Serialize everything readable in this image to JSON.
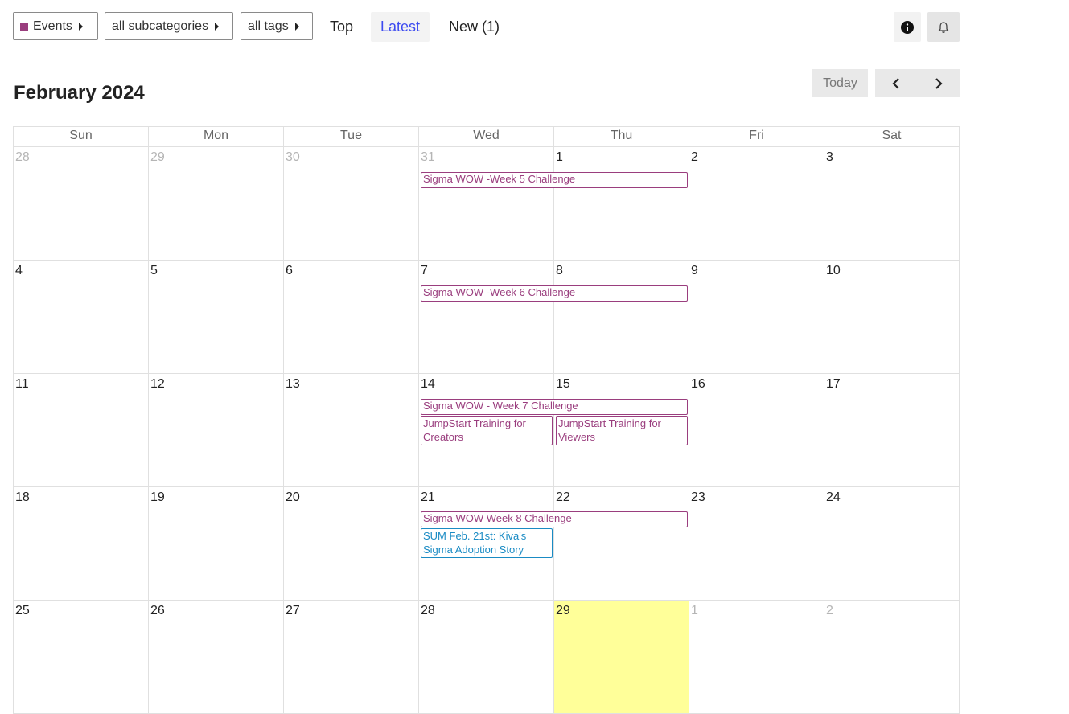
{
  "filters": {
    "category": "Events",
    "subcategory": "all subcategories",
    "tags": "all tags",
    "category_color": "#9a3e7e"
  },
  "tabs": {
    "top": "Top",
    "latest": "Latest",
    "new": "New (1)"
  },
  "icons": {
    "info": "info-icon",
    "bell": "bell-icon"
  },
  "calendar": {
    "title": "February 2024",
    "today_label": "Today",
    "weekdays": [
      "Sun",
      "Mon",
      "Tue",
      "Wed",
      "Thu",
      "Fri",
      "Sat"
    ],
    "weeks": [
      [
        "28",
        "29",
        "30",
        "31",
        "1",
        "2",
        "3"
      ],
      [
        "4",
        "5",
        "6",
        "7",
        "8",
        "9",
        "10"
      ],
      [
        "11",
        "12",
        "13",
        "14",
        "15",
        "16",
        "17"
      ],
      [
        "18",
        "19",
        "20",
        "21",
        "22",
        "23",
        "24"
      ],
      [
        "25",
        "26",
        "27",
        "28",
        "29",
        "1",
        "2"
      ]
    ],
    "events": [
      {
        "title": "Sigma WOW -Week 5 Challenge"
      },
      {
        "title": "Sigma WOW -Week 6 Challenge"
      },
      {
        "title": "Sigma WOW - Week 7 Challenge"
      },
      {
        "title": "JumpStart Training for Creators"
      },
      {
        "title": "JumpStart Training for Viewers"
      },
      {
        "title": "Sigma WOW Week 8 Challenge"
      },
      {
        "title": "SUM Feb. 21st: Kiva's Sigma Adoption Story"
      }
    ]
  }
}
